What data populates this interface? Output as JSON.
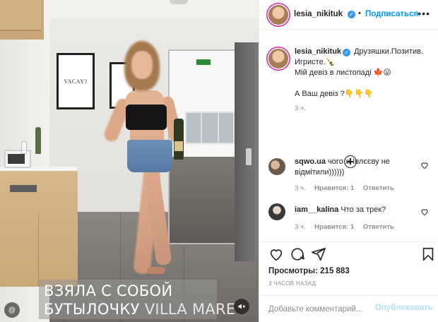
{
  "media": {
    "art_text": "VACAY?",
    "caption_line1": "ВЗЯЛА С СОБОЙ",
    "caption_line2_main": "БУТЫЛОЧКУ ",
    "caption_line2_accent": "VILLA MARE",
    "brand_mark": "@"
  },
  "header": {
    "username": "lesia_nikituk",
    "separator": "•",
    "follow_label": "Подписаться",
    "more_label": "•••"
  },
  "caption": {
    "username": "lesia_nikituk",
    "line1": " Друзяшки.Позитив.",
    "line2": "Игристе.🍾",
    "line3": "Мій девіз в листопаді 🍁😜",
    "line4": "А Ваш девіз ?👇👇👇",
    "time": "3 ч."
  },
  "comments": [
    {
      "username": "sqwo.ua",
      "text": " чого ж Івлєєву не відмітили))))))",
      "time": "3 ч.",
      "likes": "Нравится: 1",
      "reply": "Ответить"
    },
    {
      "username": "iam__kalina",
      "text": " Что за трек?",
      "time": "3 ч.",
      "likes": "Нравится: 1",
      "reply": "Ответить"
    }
  ],
  "stats": {
    "views": "Просмотры: 215 883",
    "time_ago": "3 ЧАСОВ НАЗАД"
  },
  "composer": {
    "placeholder": "Добавьте комментарий...",
    "publish_label": "Опубликовать"
  },
  "colors": {
    "accent": "#0095f6",
    "verified": "#3897f0",
    "muted_text": "#8e8e8e"
  }
}
